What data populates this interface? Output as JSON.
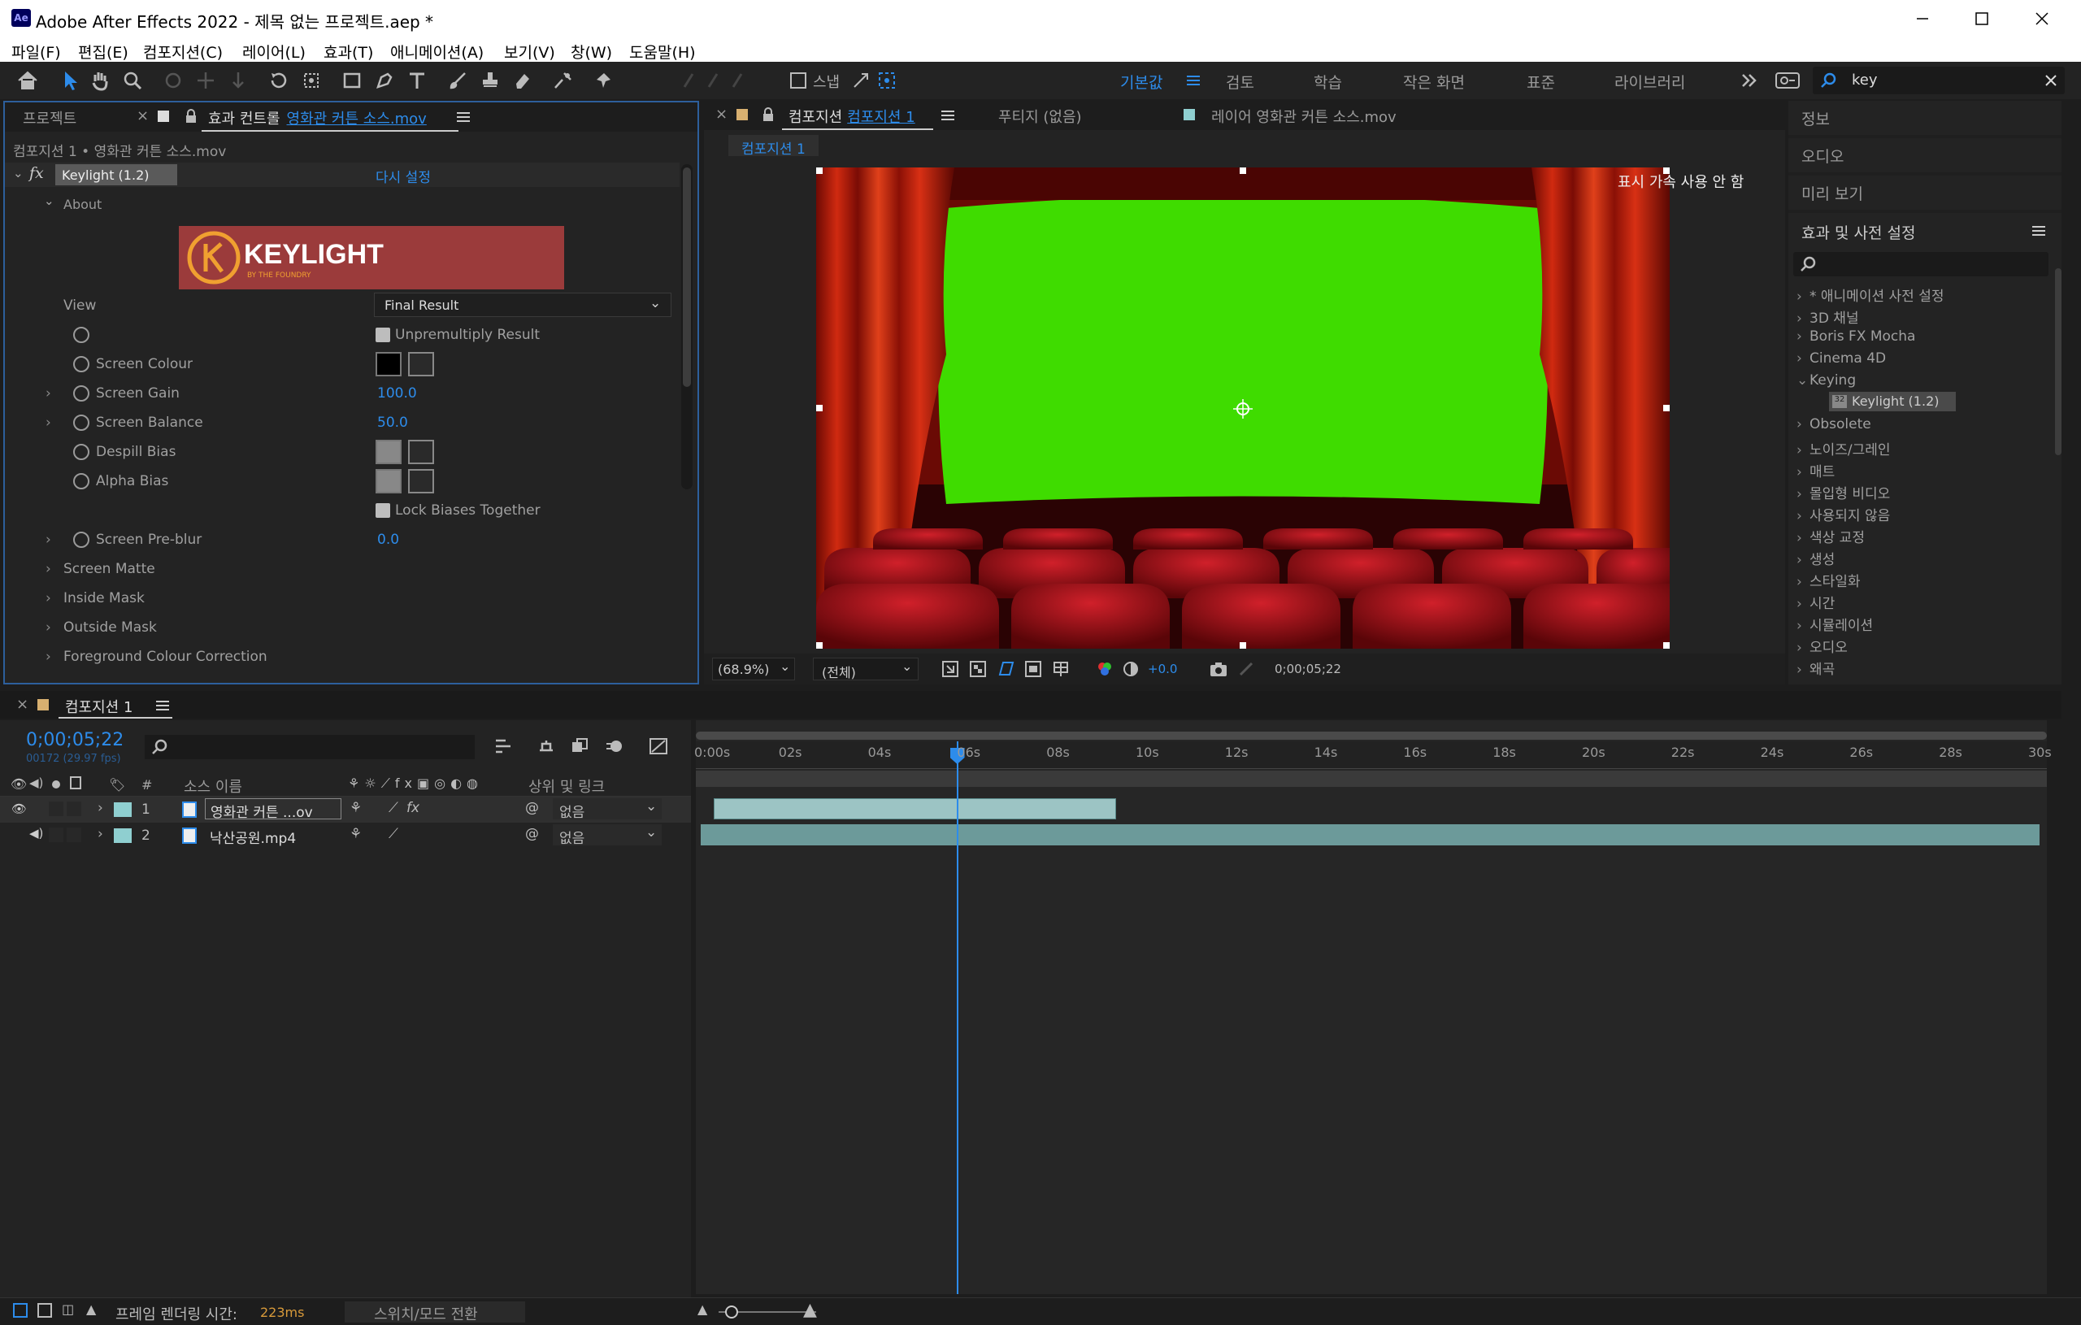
{
  "window": {
    "title": "Adobe After Effects 2022 - 제목 없는 프로젝트.aep *",
    "app_badge": "Ae"
  },
  "menu": [
    "파일(F)",
    "편집(E)",
    "컴포지션(C)",
    "레이어(L)",
    "효과(T)",
    "애니메이션(A)",
    "보기(V)",
    "창(W)",
    "도움말(H)"
  ],
  "toolbar": {
    "snap_label": "스냅",
    "workspaces": [
      "기본값",
      "검토",
      "학습",
      "작은 화면",
      "표준",
      "라이브러리"
    ],
    "active_workspace": "기본값",
    "search_value": "key"
  },
  "effect_controls": {
    "tab_project": "프로젝트",
    "tab_prefix": "효과 컨트롤",
    "tab_layer": "영화관 커튼 소스.mov",
    "breadcrumb": "컴포지션 1 • 영화관 커튼 소스.mov",
    "effect_name": "Keylight (1.2)",
    "reset_label": "다시 설정",
    "about_label": "About",
    "logo_text": "KEYLIGHT",
    "logo_sub": "BY THE FOUNDRY",
    "view_label": "View",
    "view_value": "Final Result",
    "unpremultiply_label": "Unpremultiply Result",
    "screen_colour_label": "Screen Colour",
    "screen_gain_label": "Screen Gain",
    "screen_gain_value": "100.0",
    "screen_balance_label": "Screen Balance",
    "screen_balance_value": "50.0",
    "despill_bias_label": "Despill Bias",
    "alpha_bias_label": "Alpha Bias",
    "lock_biases_label": "Lock Biases Together",
    "screen_preblur_label": "Screen Pre-blur",
    "screen_preblur_value": "0.0",
    "groups": [
      "Screen Matte",
      "Inside Mask",
      "Outside Mask",
      "Foreground Colour Correction"
    ]
  },
  "viewer": {
    "comp_tab_prefix": "컴포지션",
    "comp_tab_name": "컴포지션 1",
    "footage_tab": "푸티지 (없음)",
    "layer_tab": "레이어 영화관 커튼 소스.mov",
    "comp_chip": "컴포지션 1",
    "accel_notice": "표시 가속 사용 안 함",
    "zoom": "(68.9%)",
    "resolution": "(전체)",
    "exposure": "+0.0",
    "timecode": "0;00;05;22"
  },
  "right_panels": {
    "info": "정보",
    "audio": "오디오",
    "preview": "미리 보기",
    "effects_title": "효과 및 사전 설정",
    "effects_list": [
      "* 애니메이션 사전 설정",
      "3D 채널",
      "Boris FX Mocha",
      "Cinema 4D",
      "Keying",
      "Obsolete",
      "노이즈/그레인",
      "매트",
      "몰입형 비디오",
      "사용되지 않음",
      "색상 교정",
      "생성",
      "스타일화",
      "시간",
      "시뮬레이션",
      "오디오",
      "왜곡"
    ],
    "keying_child": "Keylight (1.2)"
  },
  "timeline": {
    "tab": "컴포지션 1",
    "timecode": "0;00;05;22",
    "frame_info": "00172 (29.97 fps)",
    "col_source": "소스 이름",
    "col_parent": "상위 및 링크",
    "col_num": "#",
    "layers": [
      {
        "num": "1",
        "name": "영화관 커튼 ...ov",
        "parent": "없음"
      },
      {
        "num": "2",
        "name": "낙산공원.mp4",
        "parent": "없음"
      }
    ],
    "ruler": [
      "0:00s",
      "02s",
      "04s",
      "06s",
      "08s",
      "10s",
      "12s",
      "14s",
      "16s",
      "18s",
      "20s",
      "22s",
      "24s",
      "26s",
      "28s",
      "30s"
    ],
    "playhead_seconds": 5.73,
    "layer1_range_seconds": [
      0.3,
      9.3
    ],
    "layer2_range_seconds": [
      0,
      30
    ]
  },
  "statusbar": {
    "render_label": "프레임 렌더링 시간:",
    "render_value": "223ms",
    "switch_label": "스위치/모드 전환"
  },
  "colors": {
    "accent": "#2d8ceb",
    "green_screen": "#3fdc00",
    "curtain": "#b51a0c",
    "layer_label": "#8fcfd0"
  }
}
